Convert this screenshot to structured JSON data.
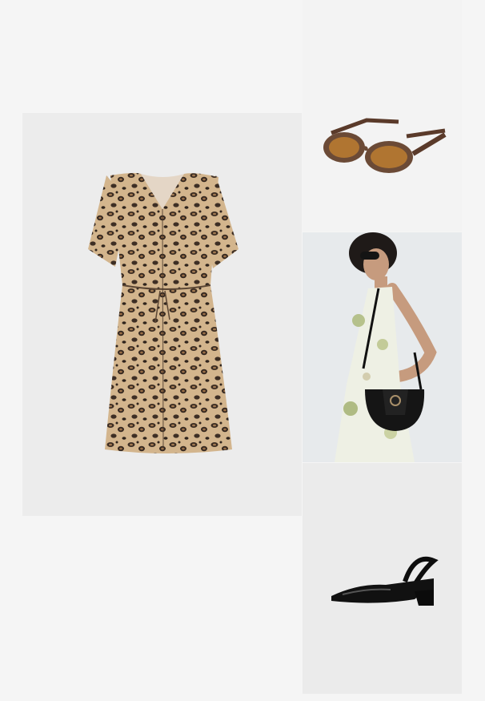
{
  "products": [
    {
      "item": "leopard-print-dress"
    },
    {
      "item": "tortoiseshell-sunglasses"
    },
    {
      "item": "black-saddle-bag"
    },
    {
      "item": "black-patent-slingback-shoes"
    }
  ]
}
